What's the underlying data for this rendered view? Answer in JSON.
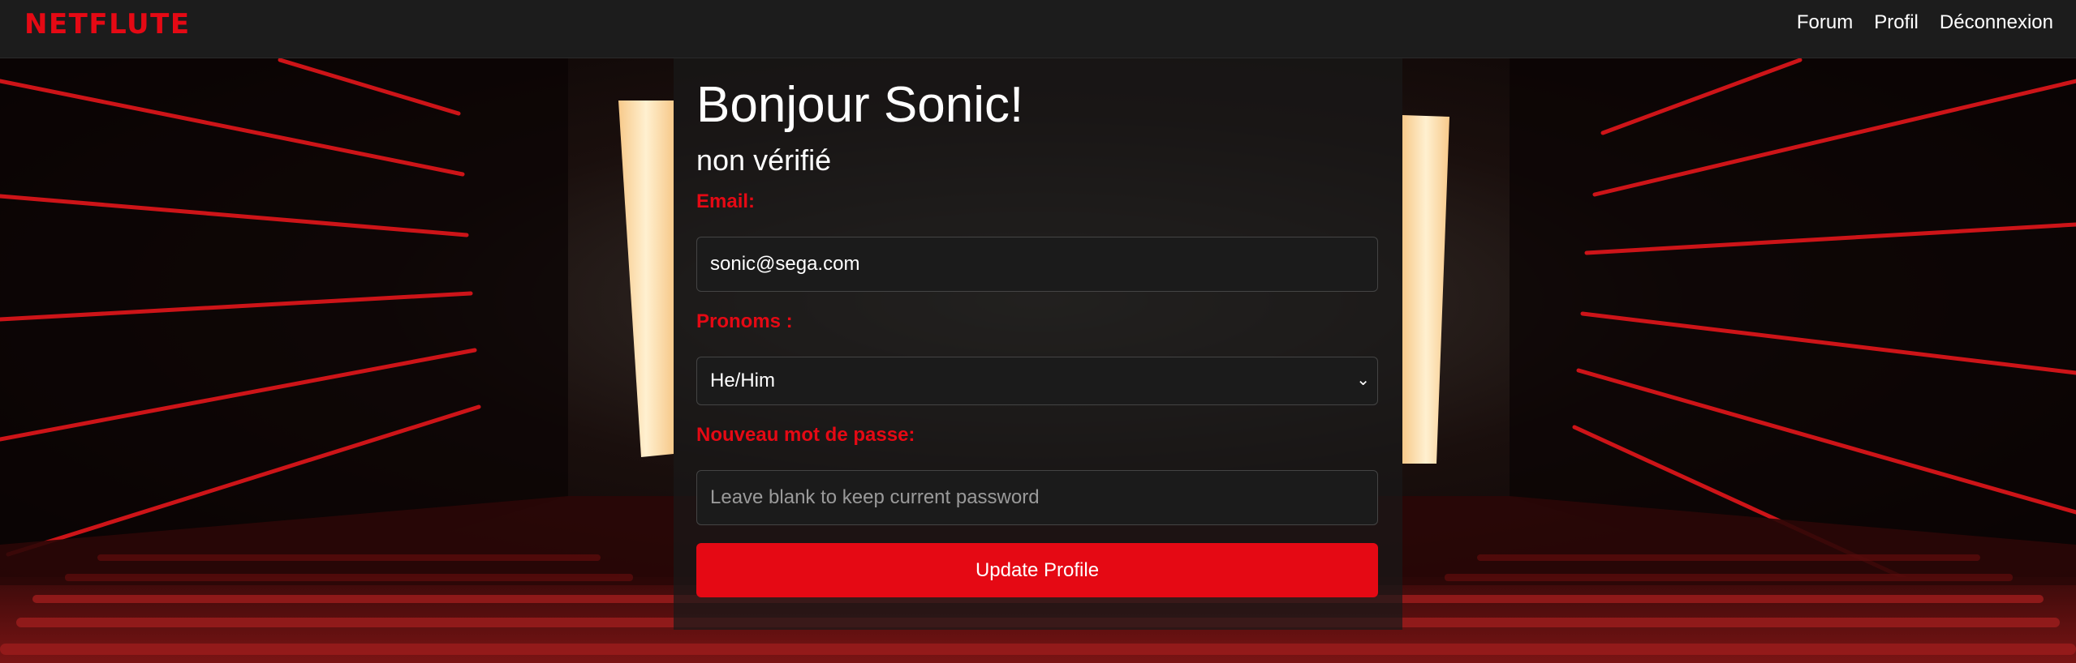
{
  "header": {
    "logo": "NETFLUTE",
    "nav": [
      {
        "label": "Forum"
      },
      {
        "label": "Profil"
      },
      {
        "label": "Déconnexion"
      }
    ]
  },
  "profile": {
    "greeting": "Bonjour Sonic!",
    "status": "non vérifié",
    "email_label": "Email:",
    "email_value": "sonic@sega.com",
    "pronouns_label": "Pronoms :",
    "pronouns_value": "He/Him",
    "password_label": "Nouveau mot de passe:",
    "password_placeholder": "Leave blank to keep current password",
    "submit_label": "Update Profile"
  },
  "colors": {
    "accent": "#e50914",
    "navbar_bg": "#1c1c1c",
    "card_bg": "#191919"
  },
  "icons": {
    "select_chevron": "chevron-down-icon"
  }
}
